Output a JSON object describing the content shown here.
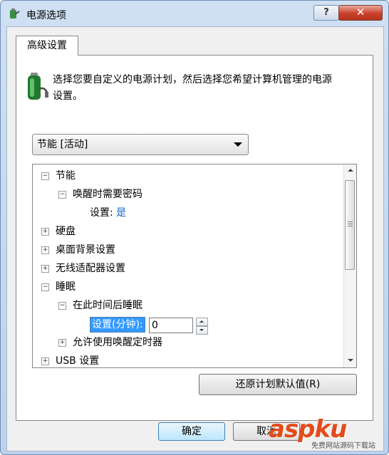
{
  "window": {
    "title": "电源选项",
    "help_label": "?",
    "close_label": "✕"
  },
  "tab": {
    "label": "高级设置"
  },
  "description": "选择您要自定义的电源计划，然后选择您希望计算机管理的电源设置。",
  "plan_select": {
    "value": "节能 [活动]"
  },
  "tree": {
    "energy_saver": "节能",
    "require_password": "唤醒时需要密码",
    "setting_label": "设置:",
    "setting_value": "是",
    "hard_disk": "硬盘",
    "desktop_background": "桌面背景设置",
    "wireless_adapter": "无线适配器设置",
    "sleep": "睡眠",
    "sleep_after": "在此时间后睡眠",
    "spin_label": "设置(分钟):",
    "spin_value": "0",
    "allow_wake_timers": "允许使用唤醒定时器",
    "usb": "USB 设置",
    "expand_symbol": "+",
    "collapse_symbol": "−"
  },
  "buttons": {
    "restore": "还原计划默认值(R)",
    "ok": "确定",
    "cancel": "取消"
  },
  "watermark": {
    "text": "aspku",
    "sub": "免费网站源码下载站"
  },
  "colors": {
    "selection": "#3399ff",
    "setting_value": "#1565c0",
    "close_button": "#c9402c"
  }
}
